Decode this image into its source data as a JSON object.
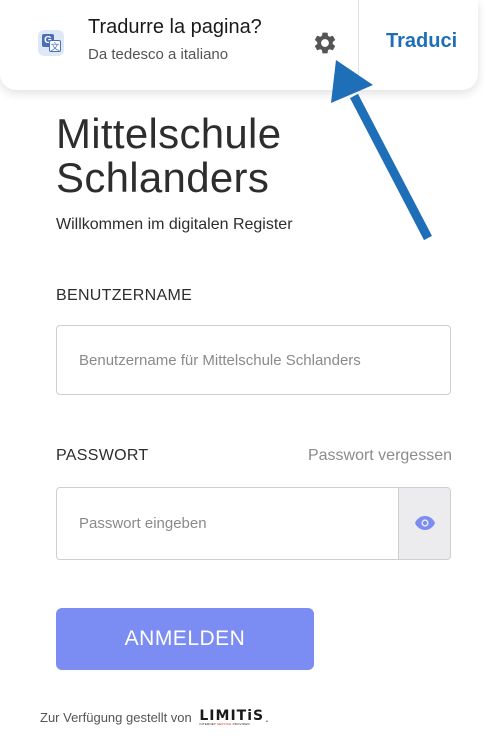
{
  "translate_bar": {
    "title": "Tradurre la pagina?",
    "subtitle": "Da tedesco a italiano",
    "translate_button": "Traduci",
    "icon": "google-translate-icon",
    "settings_icon": "gear-icon",
    "accent_color": "#1f6fb8"
  },
  "annotation": {
    "arrow_color": "#1f6fb8"
  },
  "header": {
    "title": "Mittelschule Schlanders",
    "welcome": "Willkommen im digitalen Register"
  },
  "form": {
    "username_label": "BENUTZERNAME",
    "username_placeholder": "Benutzername für Mittelschule Schlanders",
    "password_label": "PASSWORT",
    "forgot_password": "Passwort vergessen",
    "password_placeholder": "Passwort eingeben",
    "show_password_icon": "eye-icon",
    "login_button": "ANMELDEN",
    "login_button_color": "#7b8cf2"
  },
  "footer": {
    "provided_by": "Zur Verfügung gestellt von",
    "logo_text": "LIMITiS",
    "logo_tagline_a": "INTERNET",
    "logo_tagline_b": "SERVICE",
    "logo_tagline_c": "PROVIDER",
    "logo_brand_color": "#d6262e",
    "period": "."
  }
}
